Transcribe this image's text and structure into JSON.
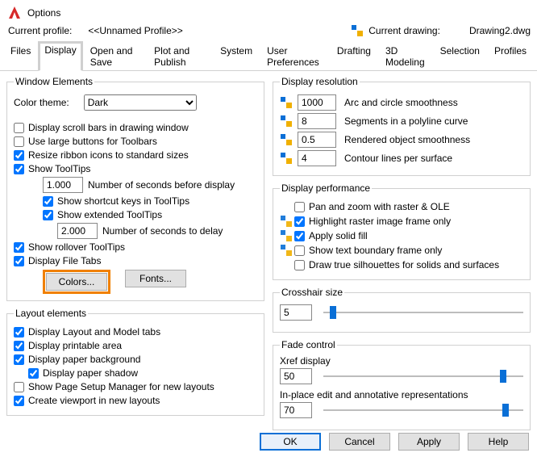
{
  "window": {
    "title": "Options"
  },
  "profile": {
    "label": "Current profile:",
    "value": "<<Unnamed Profile>>",
    "drawing_label": "Current drawing:",
    "drawing_value": "Drawing2.dwg"
  },
  "tabs": {
    "files": "Files",
    "display": "Display",
    "open_save": "Open and Save",
    "plot_publish": "Plot and Publish",
    "system": "System",
    "user_pref": "User Preferences",
    "drafting": "Drafting",
    "3d_model": "3D Modeling",
    "selection": "Selection",
    "profiles": "Profiles"
  },
  "window_elements": {
    "legend": "Window Elements",
    "color_theme_label": "Color theme:",
    "color_theme_value": "Dark",
    "scrollbars": "Display scroll bars in drawing window",
    "large_buttons": "Use large buttons for Toolbars",
    "resize_ribbon": "Resize ribbon icons to standard sizes",
    "tooltips": "Show ToolTips",
    "tt_seconds_value": "1.000",
    "tt_seconds_label": "Number of seconds before display",
    "shortcut": "Show shortcut keys in ToolTips",
    "extended": "Show extended ToolTips",
    "ext_seconds_value": "2.000",
    "ext_seconds_label": "Number of seconds to delay",
    "rollover": "Show rollover ToolTips",
    "file_tabs": "Display File Tabs",
    "colors_btn": "Colors...",
    "fonts_btn": "Fonts..."
  },
  "layout_elements": {
    "legend": "Layout elements",
    "layout_tabs": "Display Layout and Model tabs",
    "printable": "Display printable area",
    "paper_bg": "Display paper background",
    "paper_shadow": "Display paper shadow",
    "page_setup": "Show Page Setup Manager for new layouts",
    "viewport": "Create viewport in new layouts"
  },
  "display_resolution": {
    "legend": "Display resolution",
    "arc_value": "1000",
    "arc_label": "Arc and circle smoothness",
    "seg_value": "8",
    "seg_label": "Segments in a polyline curve",
    "rend_value": "0.5",
    "rend_label": "Rendered object smoothness",
    "contour_value": "4",
    "contour_label": "Contour lines per surface"
  },
  "display_performance": {
    "legend": "Display performance",
    "pan_zoom": "Pan and zoom with raster & OLE",
    "highlight_raster": "Highlight raster image frame only",
    "solid_fill": "Apply solid fill",
    "text_boundary": "Show text boundary frame only",
    "silhouettes": "Draw true silhouettes for solids and surfaces"
  },
  "crosshair": {
    "legend": "Crosshair size",
    "value": "5",
    "percent": 5
  },
  "fade": {
    "legend": "Fade control",
    "xref_label": "Xref display",
    "xref_value": "50",
    "xref_percent": 50,
    "inplace_label": "In-place edit and annotative representations",
    "inplace_value": "70",
    "inplace_percent": 70
  },
  "footer": {
    "ok": "OK",
    "cancel": "Cancel",
    "apply": "Apply",
    "help": "Help"
  }
}
